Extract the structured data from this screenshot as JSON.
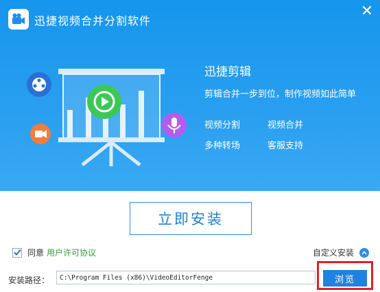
{
  "window": {
    "title": "迅捷视频合并分割软件",
    "close_glyph": "✕"
  },
  "banner": {
    "heading": "迅捷剪辑",
    "subheading": "剪辑合并一步到位，制作视频如此简单",
    "features": [
      "视频分割",
      "视频合并",
      "多种转场",
      "客服支持"
    ],
    "colors": {
      "bg": "#1a98ee",
      "accent_green": "#3cc857",
      "accent_blue": "#2b6fd6",
      "accent_orange": "#f47b3b",
      "accent_purple": "#b45cf0"
    }
  },
  "install": {
    "button_label": "立即安装"
  },
  "agreement": {
    "checked": true,
    "prefix": "同意",
    "link_text": "用户许可协议"
  },
  "custom_install": {
    "label": "自定义安装"
  },
  "path": {
    "label": "安装路径：",
    "value": "C:\\Program Files (x86)\\VideoEditorFenge"
  },
  "browse": {
    "label": "浏览"
  }
}
